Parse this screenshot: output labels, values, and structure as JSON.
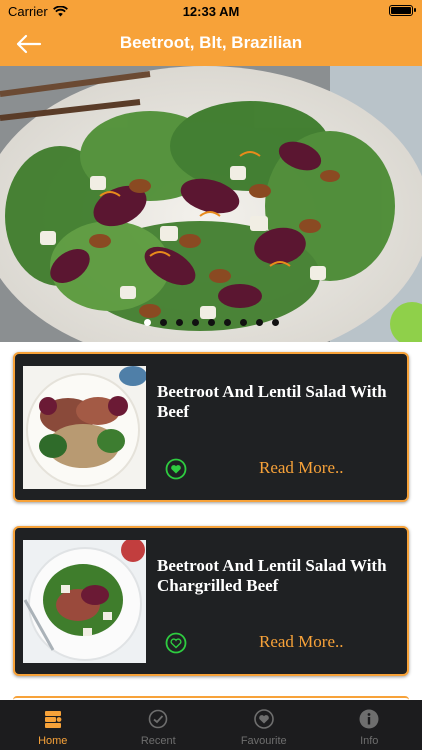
{
  "status_bar": {
    "carrier": "Carrier",
    "time": "12:33 AM"
  },
  "nav": {
    "title": "Beetroot, Blt, Brazilian",
    "back_icon": "arrow-left-icon"
  },
  "carousel": {
    "dot_count": 9,
    "active_index": 0
  },
  "recipes": [
    {
      "title": "Beetroot And Lentil Salad With Beef",
      "read_more": "Read More..",
      "favourite": true
    },
    {
      "title": "Beetroot And Lentil Salad With Chargrilled Beef",
      "read_more": "Read More..",
      "favourite": false
    }
  ],
  "tabs": [
    {
      "label": "Home",
      "icon": "home-icon",
      "active": true
    },
    {
      "label": "Recent",
      "icon": "recent-icon",
      "active": false
    },
    {
      "label": "Favourite",
      "icon": "heart-icon",
      "active": false
    },
    {
      "label": "Info",
      "icon": "info-icon",
      "active": false
    }
  ],
  "colors": {
    "accent": "#f7a239",
    "card_bg": "#1f2123",
    "heart": "#2ecc40",
    "tabbar_bg": "#1c1c1e"
  }
}
